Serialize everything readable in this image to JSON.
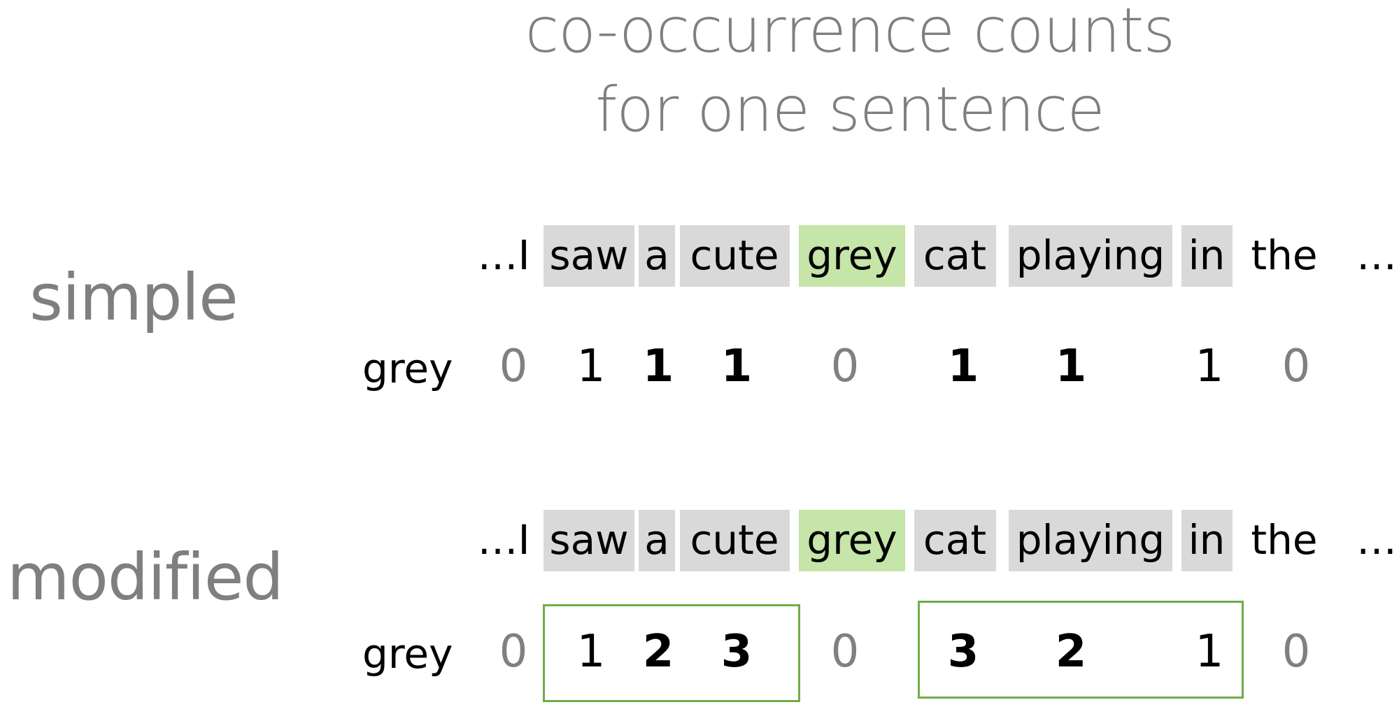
{
  "title": {
    "line1": "co-occurrence counts",
    "line2": "for one sentence"
  },
  "sections": {
    "simple": {
      "label": "simple"
    },
    "modified": {
      "label": "modified"
    }
  },
  "sentence": {
    "prefix": "…I",
    "suffix": "…",
    "words": [
      {
        "text": "saw",
        "highlight": "context"
      },
      {
        "text": "a",
        "highlight": "context"
      },
      {
        "text": "cute",
        "highlight": "context"
      },
      {
        "text": "grey",
        "highlight": "target"
      },
      {
        "text": "cat",
        "highlight": "context"
      },
      {
        "text": "playing",
        "highlight": "context"
      },
      {
        "text": "in",
        "highlight": "context"
      },
      {
        "text": "the",
        "highlight": "none"
      }
    ]
  },
  "row_label": "grey",
  "simple_counts": [
    "0",
    "1",
    "1",
    "1",
    "0",
    "1",
    "1",
    "1",
    "0"
  ],
  "modified_counts": [
    "0",
    "1",
    "2",
    "3",
    "0",
    "3",
    "2",
    "1",
    "0"
  ],
  "colors": {
    "context": "#d9d9d9",
    "target": "#c5e5a9",
    "frame": "#70ad47",
    "title": "#7f7f7f"
  }
}
